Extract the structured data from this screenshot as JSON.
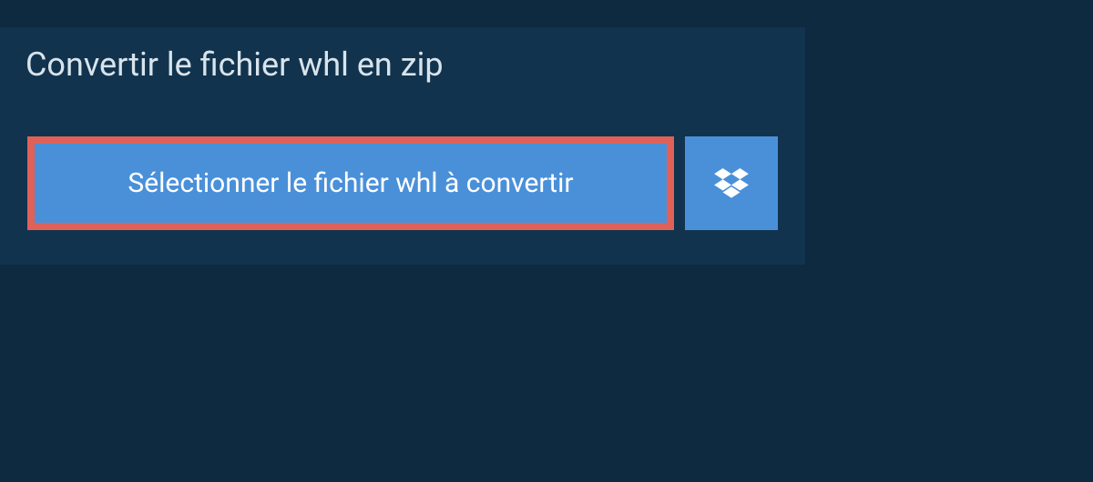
{
  "title": "Convertir le fichier whl en zip",
  "selectButton": {
    "label": "Sélectionner le fichier whl à convertir"
  },
  "colors": {
    "background": "#0e2a40",
    "panel": "#12334e",
    "button": "#4a90d9",
    "highlight": "#e06158",
    "text": "#d8e4ec"
  }
}
